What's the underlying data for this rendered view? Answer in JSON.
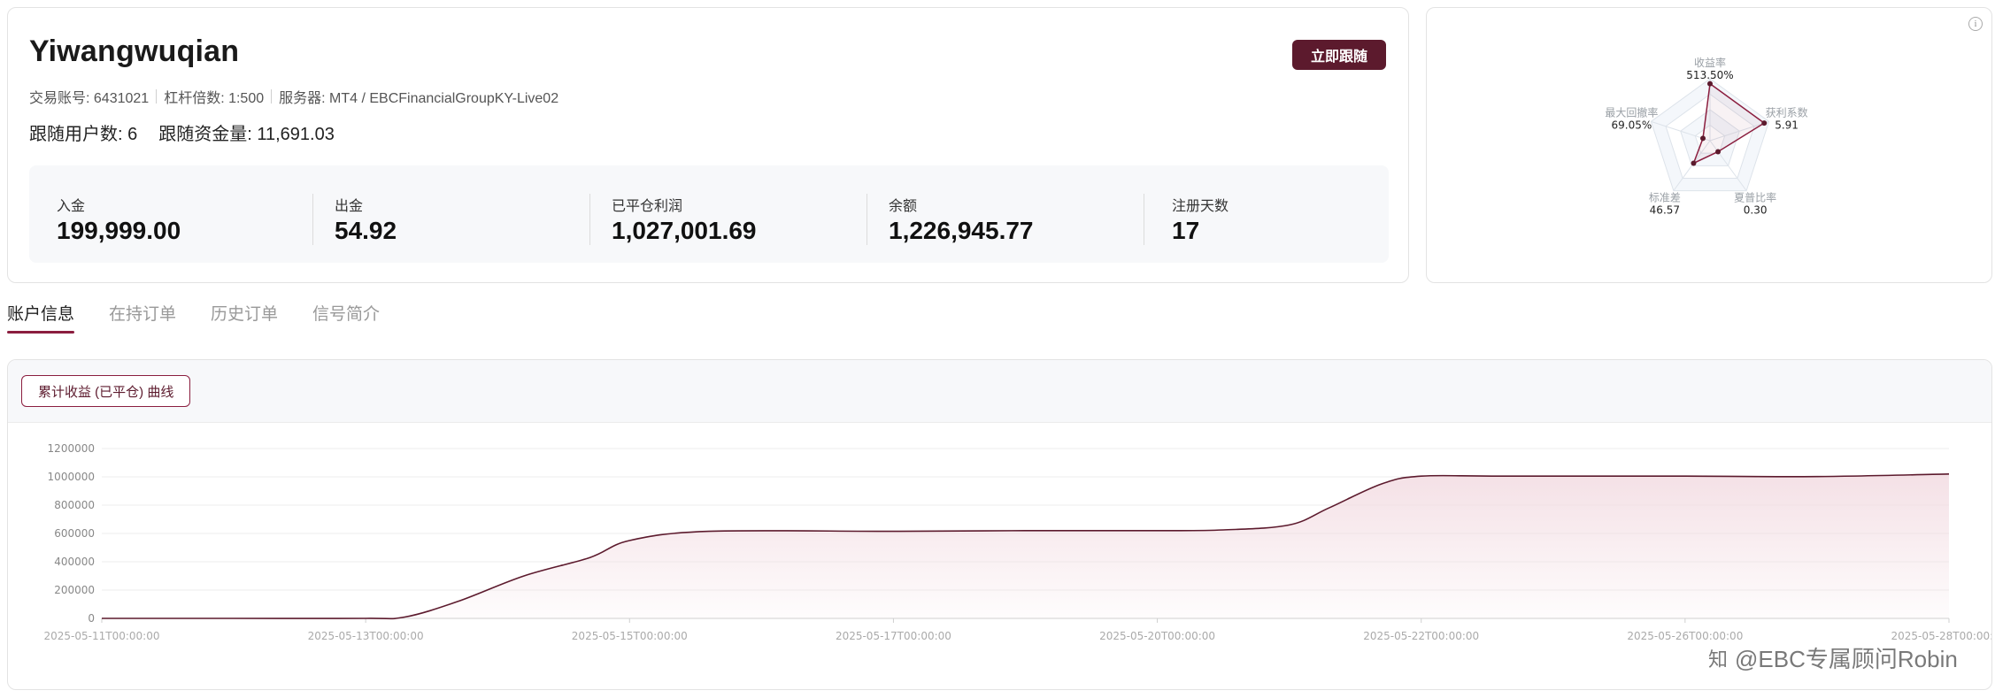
{
  "account": {
    "name": "Yiwangwuqian",
    "follow_button": "立即跟随",
    "trade_account": "交易账号: 6431021",
    "leverage": "杠杆倍数: 1:500",
    "server": "服务器: MT4 / EBCFinancialGroupKY-Live02",
    "followers": "跟随用户数: 6",
    "follow_funds": "跟随资金量: 11,691.03"
  },
  "stats": [
    {
      "label": "入金",
      "value": "199,999.00"
    },
    {
      "label": "出金",
      "value": "54.92"
    },
    {
      "label": "已平仓利润",
      "value": "1,027,001.69"
    },
    {
      "label": "余额",
      "value": "1,226,945.77"
    },
    {
      "label": "注册天数",
      "value": "17"
    }
  ],
  "radar": {
    "info_icon": "info-icon",
    "axes": [
      {
        "label": "收益率",
        "value_text": "513.50%",
        "level": 0.92
      },
      {
        "label": "获利系数",
        "value_text": "5.91",
        "level": 0.92
      },
      {
        "label": "夏普比率",
        "value_text": "0.30",
        "level": 0.22
      },
      {
        "label": "标准差",
        "value_text": "46.57",
        "level": 0.45
      },
      {
        "label": "最大回撤率",
        "value_text": "69.05%",
        "level": 0.12
      }
    ],
    "color": "#8b1e3f"
  },
  "tabs": [
    "账户信息",
    "在持订单",
    "历史订单",
    "信号简介"
  ],
  "curve_button": "累计收益 (已平仓) 曲线",
  "chart_data": {
    "type": "area",
    "title": "累计收益 (已平仓) 曲线",
    "xlabel": "",
    "ylabel": "",
    "ylim": [
      0,
      1200000
    ],
    "yticks": [
      "0",
      "200000",
      "400000",
      "600000",
      "800000",
      "1000000",
      "1200000"
    ],
    "xtick_labels": [
      "2025-05-11T00:00:00",
      "2025-05-13T00:00:00",
      "2025-05-15T00:00:00",
      "2025-05-17T00:00:00",
      "2025-05-20T00:00:00",
      "2025-05-22T00:00:00",
      "2025-05-26T00:00:00",
      "2025-05-28T00:00:00"
    ],
    "x": [
      0,
      0.5,
      1,
      1.15,
      1.35,
      1.6,
      1.85,
      2,
      2.3,
      3,
      3.5,
      4,
      4.25,
      4.5,
      4.65,
      4.85,
      5,
      5.3,
      6,
      6.5,
      7
    ],
    "y": [
      0,
      0,
      0,
      10000,
      120000,
      300000,
      430000,
      550000,
      615000,
      615000,
      620000,
      620000,
      625000,
      660000,
      780000,
      950000,
      1005000,
      1005000,
      1005000,
      1002000,
      1020000
    ],
    "line_color": "#5c1a2d",
    "fill_color": "#f3dde3",
    "grid": true
  },
  "watermark": {
    "text": "@EBC专属顾问Robin",
    "icon": "zhihu-icon"
  }
}
